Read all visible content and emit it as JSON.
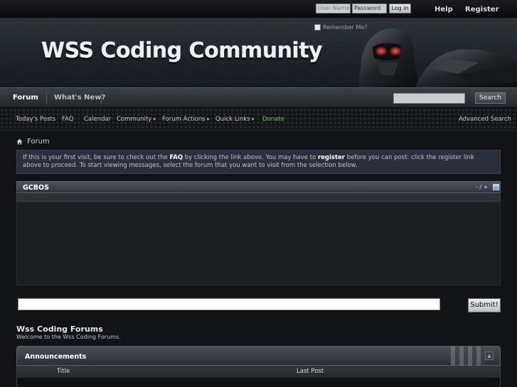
{
  "topbar": {
    "username_placeholder": "User Name",
    "password_placeholder": "Password",
    "login_label": "Log in",
    "help_label": "Help",
    "register_label": "Register"
  },
  "header": {
    "remember_label": "Remember Me?",
    "logo_text": "WSS Coding Community"
  },
  "navbar": {
    "tabs": [
      {
        "label": "Forum",
        "active": true
      },
      {
        "label": "What's New?",
        "active": false
      }
    ],
    "search_label": "Search"
  },
  "subnav": {
    "items": [
      {
        "label": "Today's Posts"
      },
      {
        "label": "FAQ"
      },
      {
        "label": "Calendar"
      },
      {
        "label": "Community"
      },
      {
        "label": "Forum Actions"
      },
      {
        "label": "Quick Links"
      },
      {
        "label": "Donate"
      }
    ],
    "caret": "▾",
    "advanced_search_label": "Advanced Search"
  },
  "breadcrumb": {
    "label": "Forum"
  },
  "notice": {
    "part1": "If this is your first visit, be sure to check out the ",
    "faq": "FAQ",
    "part2": " by clicking the link above. You may have to ",
    "register": "register",
    "part3": " before you can post: click the register link above to proceed. To start viewing messages, select the forum that you want to visit from the selection below."
  },
  "chatbox": {
    "title": "GCBOS",
    "controls": "- / +",
    "submit_label": "Submit!"
  },
  "forum": {
    "title": "Wss Coding Forums",
    "description": "Welcome to the Wss Coding Forums."
  },
  "announcements": {
    "title": "Announcements",
    "col_title": "Title",
    "col_last_post": "Last Post"
  },
  "colors": {
    "donate": "#58d13b",
    "accent_blue": "#5a8ec2"
  }
}
